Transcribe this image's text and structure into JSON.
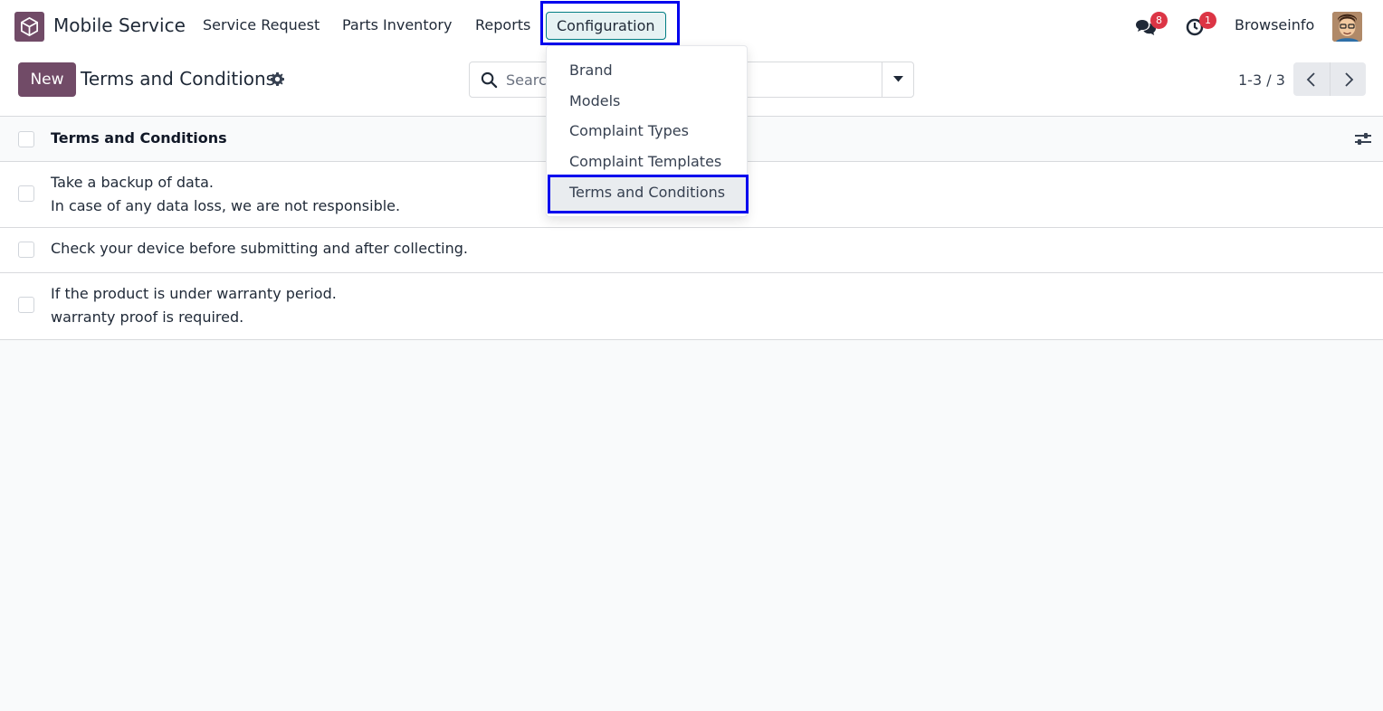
{
  "navbar": {
    "app_name": "Mobile Service",
    "menu": [
      "Service Request",
      "Parts Inventory",
      "Reports",
      "Configuration"
    ],
    "messages_count": "8",
    "activities_count": "1",
    "user_name": "Browseinfo"
  },
  "control_panel": {
    "new_label": "New",
    "title": "Terms and Conditions",
    "search_placeholder": "Search...",
    "pager": "1-3 / 3"
  },
  "list": {
    "column_header": "Terms and Conditions",
    "rows": [
      "Take a backup of data.\nIn case of any data loss, we are not responsible.",
      "Check your device before submitting and after collecting.",
      "If the product is under warranty period.\nwarranty proof is required."
    ]
  },
  "configuration_menu": {
    "items": [
      "Brand",
      "Models",
      "Complaint Types",
      "Complaint Templates",
      "Terms and Conditions"
    ],
    "active_item": "Terms and Conditions"
  },
  "colors": {
    "brand": "#714b67",
    "accent": "#017e84",
    "badge": "#dc3545",
    "highlight": "#0000ee"
  }
}
